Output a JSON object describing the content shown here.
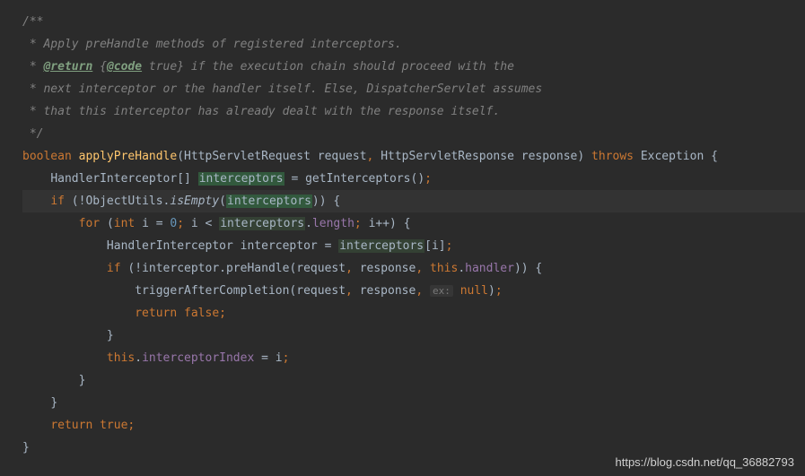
{
  "doc": {
    "l1": "/**",
    "l2": " * Apply preHandle methods of registered interceptors.",
    "l3_prefix": " * ",
    "l3_tag": "@return",
    "l3_mid": " {",
    "l3_tag2": "@code",
    "l3_suffix": " true} if the execution chain should proceed with the",
    "l4": " * next interceptor or the handler itself. Else, DispatcherServlet assumes",
    "l5": " * that this interceptor has already dealt with the response itself.",
    "l6": " */"
  },
  "code": {
    "kw_boolean": "boolean",
    "method_name": "applyPreHandle",
    "paren_open": "(",
    "type_req": "HttpServletRequest",
    "var_request": "request",
    "comma": ",",
    "type_resp": "HttpServletResponse",
    "var_response": "response",
    "paren_close": ")",
    "kw_throws": "throws",
    "type_exception": "Exception",
    "brace_open": "{",
    "brace_close": "}",
    "type_handler_interceptor": "HandlerInterceptor",
    "brackets": "[]",
    "var_interceptors": "interceptors",
    "eq": "=",
    "m_getInterceptors": "getInterceptors",
    "parens": "()",
    "semi": ";",
    "kw_if": "if",
    "bang": "!",
    "cls_ObjectUtils": "ObjectUtils",
    "dot": ".",
    "m_isEmpty": "isEmpty",
    "paren_close2": ")",
    "paren_close3": ")",
    "kw_for": "for",
    "kw_int": "int",
    "var_i": "i",
    "num_0": "0",
    "lt": "<",
    "fld_length": "length",
    "inc": "i++",
    "var_interceptor": "interceptor",
    "bracket_open": "[",
    "bracket_close": "]",
    "m_preHandle": "preHandle",
    "kw_this": "this",
    "fld_handler": "handler",
    "m_triggerAfterCompletion": "triggerAfterCompletion",
    "hint_ex": "ex:",
    "kw_null": "null",
    "kw_return": "return",
    "kw_false": "false",
    "kw_true": "true",
    "fld_interceptorIndex": "interceptorIndex"
  },
  "watermark": "https://blog.csdn.net/qq_36882793"
}
